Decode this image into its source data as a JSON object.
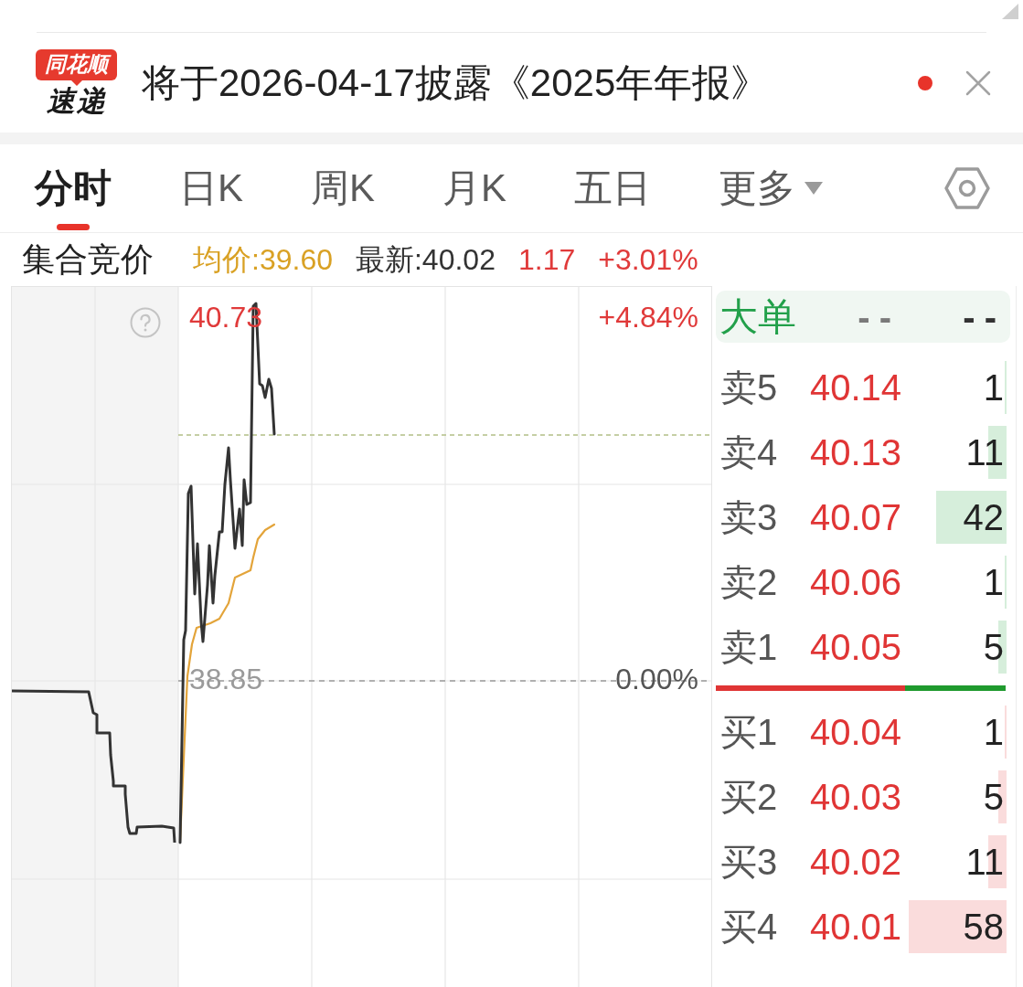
{
  "notification": {
    "logo": [
      "同花顺",
      "速递"
    ],
    "text": "将于2026-04-17披露《2025年年报》",
    "unread": true
  },
  "tabs": [
    {
      "label": "分时",
      "selected": true,
      "kind": "tab"
    },
    {
      "label": "日K",
      "selected": false,
      "kind": "tab"
    },
    {
      "label": "周K",
      "selected": false,
      "kind": "tab"
    },
    {
      "label": "月K",
      "selected": false,
      "kind": "tab"
    },
    {
      "label": "五日",
      "selected": false,
      "kind": "tab"
    },
    {
      "label": "更多",
      "selected": false,
      "kind": "menu"
    }
  ],
  "quote_bar": {
    "session": "集合竞价",
    "items": [
      {
        "text": "均价:39.60",
        "color": "#d9a124"
      },
      {
        "text": "最新:40.02",
        "color": "#333333"
      },
      {
        "text": "1.17",
        "color": "#e03a3a"
      },
      {
        "text": "+3.01%",
        "color": "#e03a3a"
      }
    ]
  },
  "chart": {
    "axis_labels": [
      {
        "kind": "high",
        "price": "40.73",
        "change": "+4.84%"
      },
      {
        "kind": "base",
        "price": "38.85",
        "change": "0.00%"
      }
    ]
  },
  "order_book": {
    "header": {
      "label": "大单",
      "values": [
        "--",
        "--"
      ]
    },
    "asks": [
      {
        "label": "卖5",
        "price": "40.14",
        "volume": "1"
      },
      {
        "label": "卖4",
        "price": "40.13",
        "volume": "11"
      },
      {
        "label": "卖3",
        "price": "40.07",
        "volume": "42"
      },
      {
        "label": "卖2",
        "price": "40.06",
        "volume": "1"
      },
      {
        "label": "卖1",
        "price": "40.05",
        "volume": "5"
      }
    ],
    "ratio": {
      "level": 0.653
    },
    "bids": [
      {
        "label": "买1",
        "price": "40.04",
        "volume": "1"
      },
      {
        "label": "买2",
        "price": "40.03",
        "volume": "5"
      },
      {
        "label": "买3",
        "price": "40.02",
        "volume": "11"
      },
      {
        "label": "买4",
        "price": "40.01",
        "volume": "58"
      }
    ]
  }
}
